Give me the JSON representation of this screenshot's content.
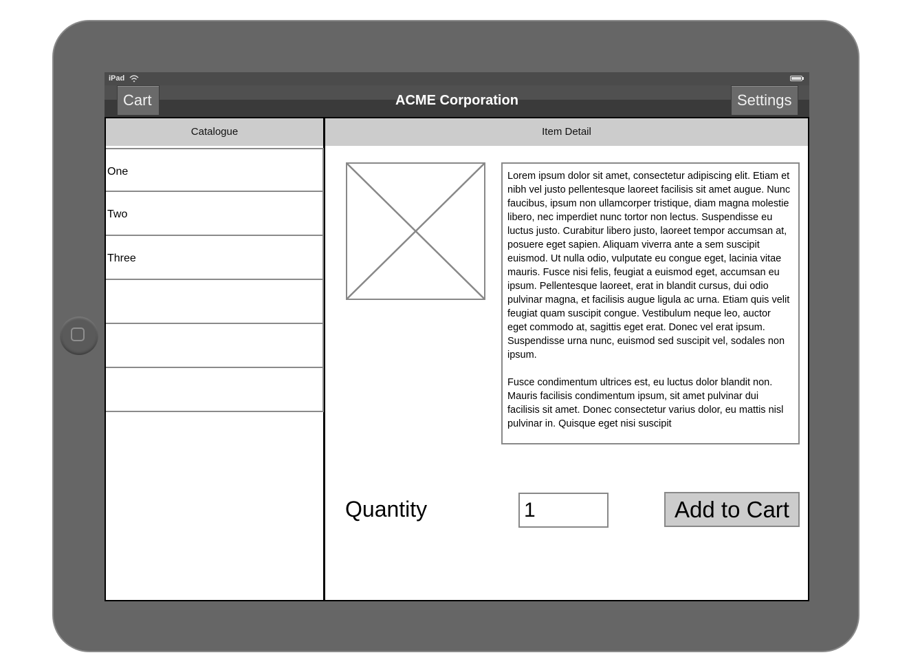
{
  "status_bar": {
    "carrier": "iPad",
    "icons": [
      "wifi-icon",
      "battery-icon"
    ]
  },
  "nav_bar": {
    "title": "ACME Corporation",
    "left_button": "Cart",
    "right_button": "Settings"
  },
  "catalogue": {
    "header": "Catalogue",
    "items": [
      "One",
      "Two",
      "Three",
      "",
      "",
      ""
    ]
  },
  "detail": {
    "header": "Item Detail",
    "image_icon": "image-placeholder-icon",
    "description_paragraphs": [
      "Lorem ipsum dolor sit amet, consectetur adipiscing elit. Etiam et nibh vel justo pellentesque laoreet facilisis sit amet augue. Nunc faucibus, ipsum non ullamcorper tristique, diam magna molestie libero, nec imperdiet nunc tortor non lectus. Suspendisse eu luctus justo. Curabitur libero justo, laoreet tempor accumsan at, posuere eget sapien. Aliquam viverra ante a sem suscipit euismod. Ut nulla odio, vulputate eu congue eget, lacinia vitae mauris. Fusce nisi felis, feugiat a euismod eget, accumsan eu ipsum. Pellentesque laoreet, erat in blandit cursus, dui odio pulvinar magna, et facilisis augue ligula ac urna. Etiam quis velit feugiat quam suscipit congue. Vestibulum neque leo, auctor eget commodo at, sagittis eget erat. Donec vel erat ipsum. Suspendisse urna nunc, euismod sed suscipit vel, sodales non ipsum.",
      "Fusce condimentum ultrices est, eu luctus dolor blandit non. Mauris facilisis condimentum ipsum, sit amet pulvinar dui facilisis sit amet. Donec consectetur varius dolor, eu mattis nisl pulvinar in. Quisque eget nisi suscipit"
    ],
    "quantity_label": "Quantity",
    "quantity_value": "1",
    "add_button": "Add to Cart"
  }
}
